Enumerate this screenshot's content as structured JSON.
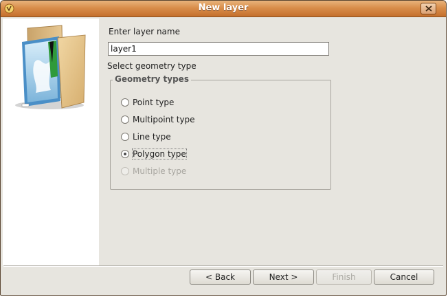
{
  "window": {
    "title": "New layer"
  },
  "form": {
    "name_label": "Enter layer name",
    "name_value": "layer1",
    "geometry_label": "Select geometry type",
    "group_title": "Geometry types",
    "options": [
      {
        "label": "Point type",
        "checked": false,
        "enabled": true
      },
      {
        "label": "Multipoint type",
        "checked": false,
        "enabled": true
      },
      {
        "label": "Line type",
        "checked": false,
        "enabled": true
      },
      {
        "label": "Polygon type",
        "checked": true,
        "enabled": true
      },
      {
        "label": "Multiple type",
        "checked": false,
        "enabled": false
      }
    ]
  },
  "buttons": {
    "back": "< Back",
    "next": "Next >",
    "finish": "Finish",
    "cancel": "Cancel"
  },
  "icons": {
    "app": "app-icon",
    "close": "close-icon",
    "illustration": "folder-map-icon"
  },
  "colors": {
    "titlebar": "#d98e4b",
    "dialog_bg": "#e7e5df"
  }
}
